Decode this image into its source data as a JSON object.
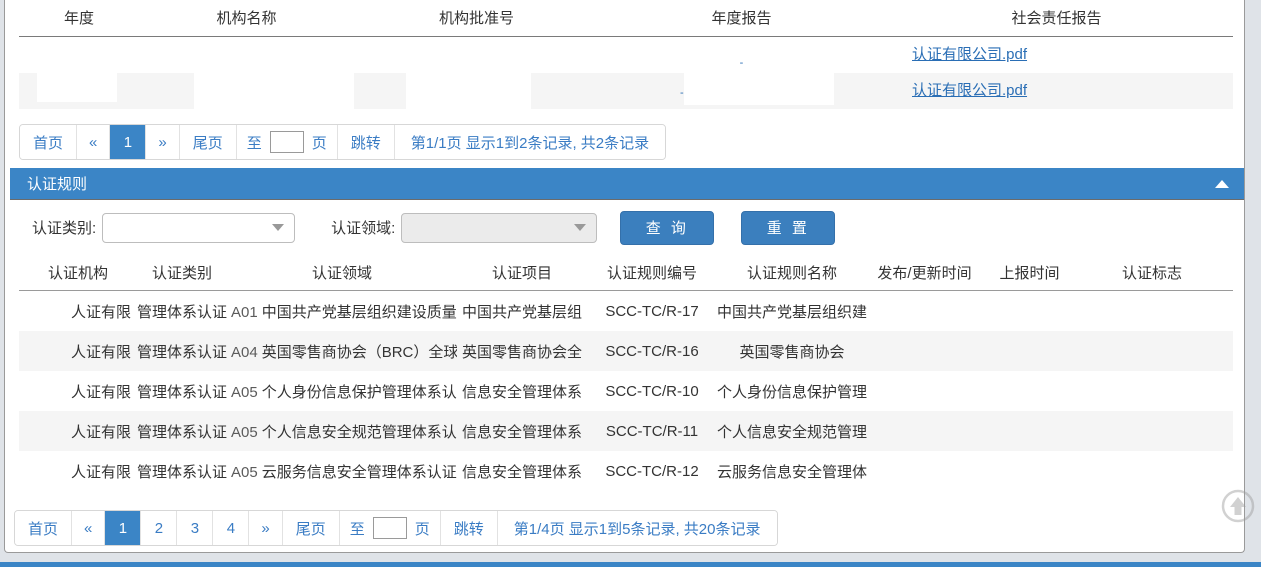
{
  "top_table": {
    "headers": [
      "年度",
      "机构名称",
      "机构批准号",
      "年度报告",
      "社会责任报告"
    ],
    "rows": [
      {
        "year": "",
        "org_name": "",
        "approval_no": "",
        "annual_report": "-",
        "social_report": "认证有限公司.pdf"
      },
      {
        "year": "",
        "org_name": "",
        "approval_no": "",
        "annual_report": "-",
        "social_report": "认证有限公司.pdf"
      }
    ]
  },
  "top_pager": {
    "first": "首页",
    "prev": "«",
    "pages": [
      "1"
    ],
    "active_page": "1",
    "next": "»",
    "last": "尾页",
    "goto_prefix": "至",
    "goto_value": "",
    "goto_suffix": "页",
    "jump": "跳转",
    "info": "第1/1页 显示1到2条记录, 共2条记录"
  },
  "rule_panel": {
    "title": "认证规则",
    "collapse_icon": "triangle-up-icon",
    "filters": {
      "type_label": "认证类别:",
      "type_value": "",
      "field_label": "认证领域:",
      "field_value": "",
      "field_disabled": true,
      "search_button": "查 询",
      "reset_button": "重 置"
    }
  },
  "rule_table": {
    "headers": [
      "认证机构",
      "认证类别",
      "认证领域",
      "认证项目",
      "认证规则编号",
      "认证规则名称",
      "发布/更新时间",
      "上报时间",
      "认证标志"
    ],
    "rows": [
      {
        "org": "人证有限",
        "type": "管理体系认证",
        "field_code": "A01",
        "field": "中国共产党基层组织建设质量",
        "project": "中国共产党基层组",
        "rule_no": "SCC-TC/R-17",
        "rule_name": "中国共产党基层组织建",
        "publish_time": "",
        "report_time": "",
        "flag": "",
        "expand_icon": "chevron-double-down-icon"
      },
      {
        "org": "人证有限",
        "type": "管理体系认证",
        "field_code": "A04",
        "field": "英国零售商协会（BRC）全球",
        "project": "英国零售商协会全",
        "rule_no": "SCC-TC/R-16",
        "rule_name": "英国零售商协会",
        "publish_time": "",
        "report_time": "",
        "flag": "",
        "expand_icon": "chevron-double-down-icon"
      },
      {
        "org": "人证有限",
        "type": "管理体系认证",
        "field_code": "A05",
        "field": "个人身份信息保护管理体系认",
        "project": "信息安全管理体系",
        "rule_no": "SCC-TC/R-10",
        "rule_name": "个人身份信息保护管理",
        "publish_time": "",
        "report_time": "",
        "flag": "",
        "expand_icon": "chevron-double-down-icon"
      },
      {
        "org": "人证有限",
        "type": "管理体系认证",
        "field_code": "A05",
        "field": "个人信息安全规范管理体系认",
        "project": "信息安全管理体系",
        "rule_no": "SCC-TC/R-11",
        "rule_name": "个人信息安全规范管理",
        "publish_time": "",
        "report_time": "",
        "flag": "",
        "expand_icon": "chevron-double-down-icon"
      },
      {
        "org": "人证有限",
        "type": "管理体系认证",
        "field_code": "A05",
        "field": "云服务信息安全管理体系认证",
        "project": "信息安全管理体系",
        "rule_no": "SCC-TC/R-12",
        "rule_name": "云服务信息安全管理体",
        "publish_time": "",
        "report_time": "",
        "flag": "",
        "expand_icon": "chevron-double-down-icon"
      }
    ]
  },
  "bottom_pager": {
    "first": "首页",
    "prev": "«",
    "pages": [
      "1",
      "2",
      "3",
      "4"
    ],
    "active_page": "1",
    "next": "»",
    "last": "尾页",
    "goto_prefix": "至",
    "goto_value": "",
    "goto_suffix": "页",
    "jump": "跳转",
    "info": "第1/4页 显示1到5条记录, 共20条记录"
  },
  "to_top": {
    "icon": "arrow-up-circle-icon"
  },
  "colors": {
    "accent": "#3b85c6",
    "link": "#3a7cc4",
    "button": "#3b7fbe",
    "row_alt": "#f5f5f5",
    "page_bg": "#dfe3e8"
  }
}
